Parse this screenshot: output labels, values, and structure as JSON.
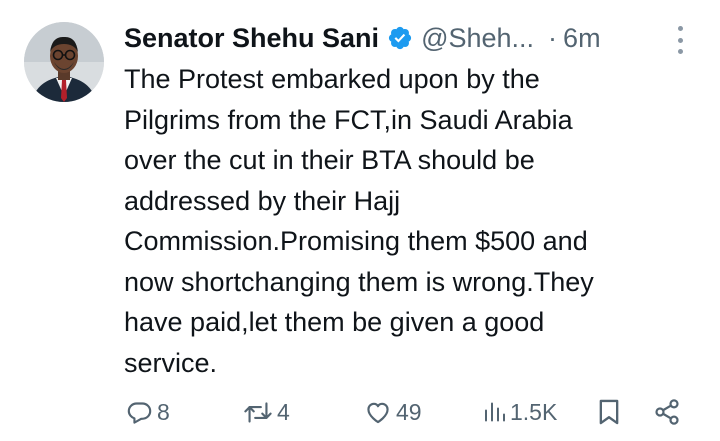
{
  "tweet": {
    "author_name": "Senator Shehu Sani",
    "handle": "@Sheh...",
    "separator": "·",
    "time": "6m",
    "text": "The Protest embarked upon by the\nPilgrims from the FCT,in Saudi Arabia\nover the cut in their BTA should be\naddressed by their Hajj\nCommission.Promising them $500 and\nnow shortchanging them is wrong.They\nhave paid,let them be given a good\nservice."
  },
  "actions": {
    "replies": "8",
    "reposts": "4",
    "likes": "49",
    "views": "1.5K"
  },
  "icons": {
    "verified": "verified-badge-icon",
    "more": "more-options-icon",
    "reply": "reply-icon",
    "repost": "repost-icon",
    "like": "heart-icon",
    "views": "views-chart-icon",
    "bookmark": "bookmark-icon",
    "share": "share-icon"
  },
  "colors": {
    "verified": "#1d9bf0",
    "text": "#0f1419",
    "secondary": "#536471"
  }
}
